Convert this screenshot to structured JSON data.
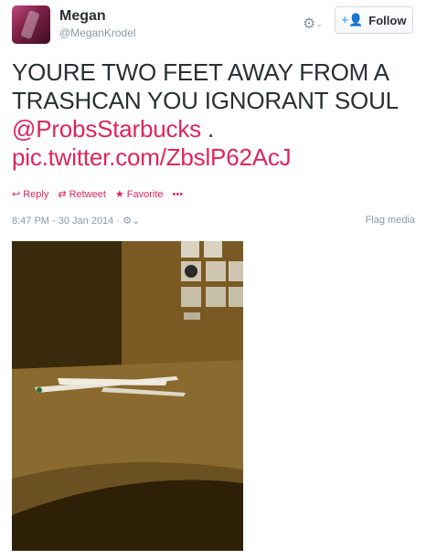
{
  "user": {
    "name": "Megan",
    "handle": "@MeganKrodel"
  },
  "header": {
    "gear_icon": "gear-icon",
    "follow_label": "Follow"
  },
  "tweet": {
    "line1": "YOURE TWO FEET AWAY FROM A",
    "line2": "TRASHCAN YOU IGNORANT SOUL",
    "mention": "@ProbsStarbucks",
    "period": " .",
    "pic_link": "pic.twitter.com/ZbslP62AcJ"
  },
  "actions": {
    "reply": "Reply",
    "retweet": "Retweet",
    "favorite": "Favorite",
    "more": "•••"
  },
  "meta": {
    "timestamp": "8:47 PM - 30 Jan 2014 ·",
    "flag": "Flag media"
  },
  "colors": {
    "link": "#e0245e",
    "muted": "#8899a6",
    "accent": "#55acee"
  }
}
